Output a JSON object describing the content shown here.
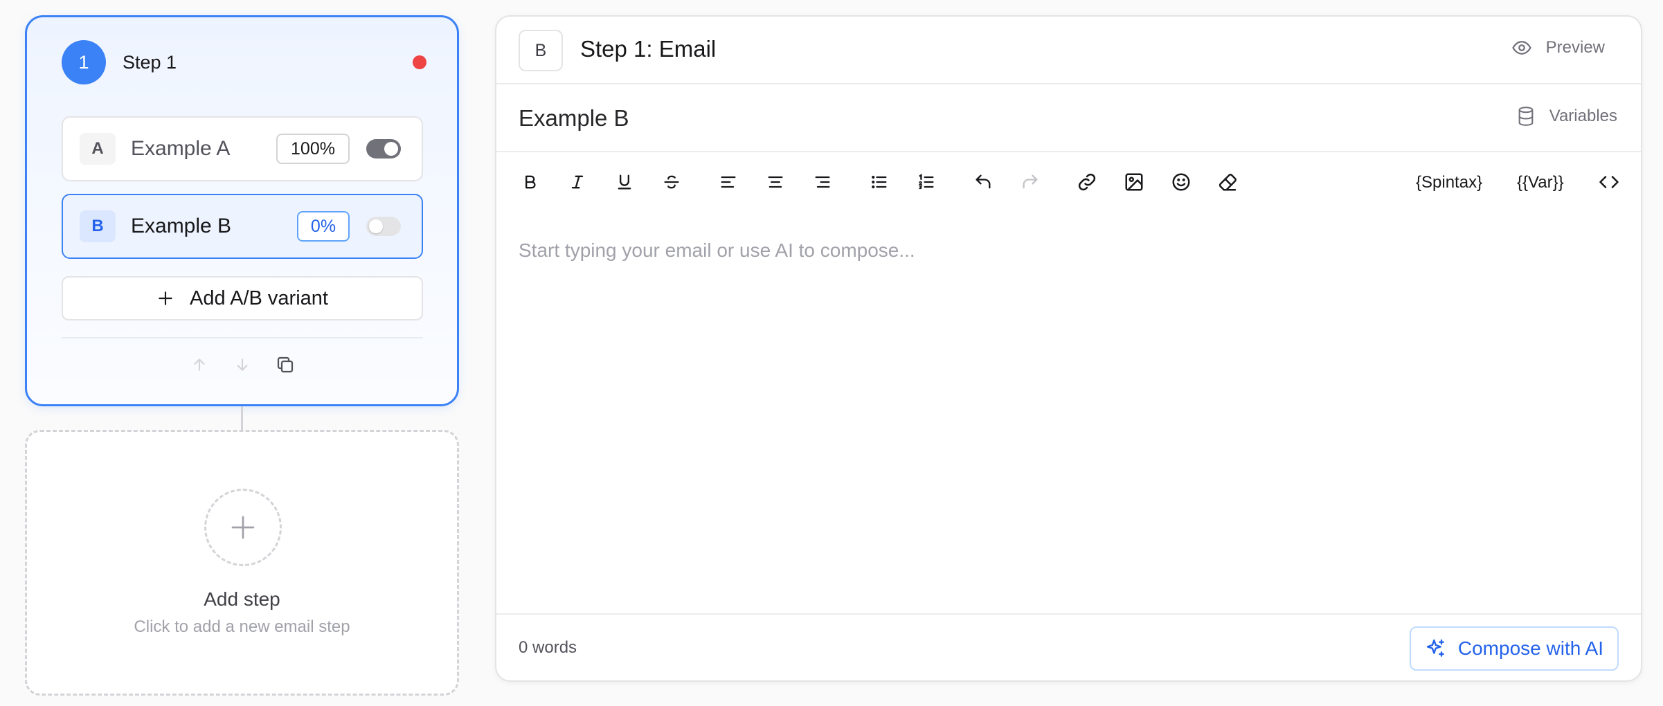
{
  "step": {
    "number": "1",
    "title": "Step 1",
    "status_color": "#ef4444",
    "variants": [
      {
        "letter": "A",
        "name": "Example A",
        "percent": "100%",
        "enabled": true
      },
      {
        "letter": "B",
        "name": "Example B",
        "percent": "0%",
        "enabled": false,
        "selected": true
      }
    ],
    "add_variant_label": "Add A/B variant",
    "actions": [
      "arrow-up-icon",
      "arrow-down-icon",
      "copy-icon"
    ]
  },
  "add_step": {
    "title": "Add step",
    "subtitle": "Click to add a new email step"
  },
  "editor": {
    "badge": "B",
    "title": "Step 1: Email",
    "preview_label": "Preview",
    "subject": "Example B",
    "variables_label": "Variables",
    "toolbar": {
      "icons": [
        "bold-icon",
        "italic-icon",
        "underline-icon",
        "strikethrough-icon",
        "align-left-icon",
        "align-center-icon",
        "align-right-icon",
        "bullet-list-icon",
        "numbered-list-icon",
        "undo-icon",
        "redo-icon",
        "link-icon",
        "image-icon",
        "emoji-icon",
        "eraser-icon",
        "code-icon"
      ],
      "spintax_label": "{Spintax}",
      "var_label": "{{Var}}"
    },
    "body_placeholder": "Start typing your email or use AI to compose...",
    "word_count": "0 words",
    "compose_label": "Compose with AI"
  },
  "colors": {
    "accent": "#3b82f6",
    "accent_text": "#2563eb",
    "status_dot": "#ef4444"
  }
}
